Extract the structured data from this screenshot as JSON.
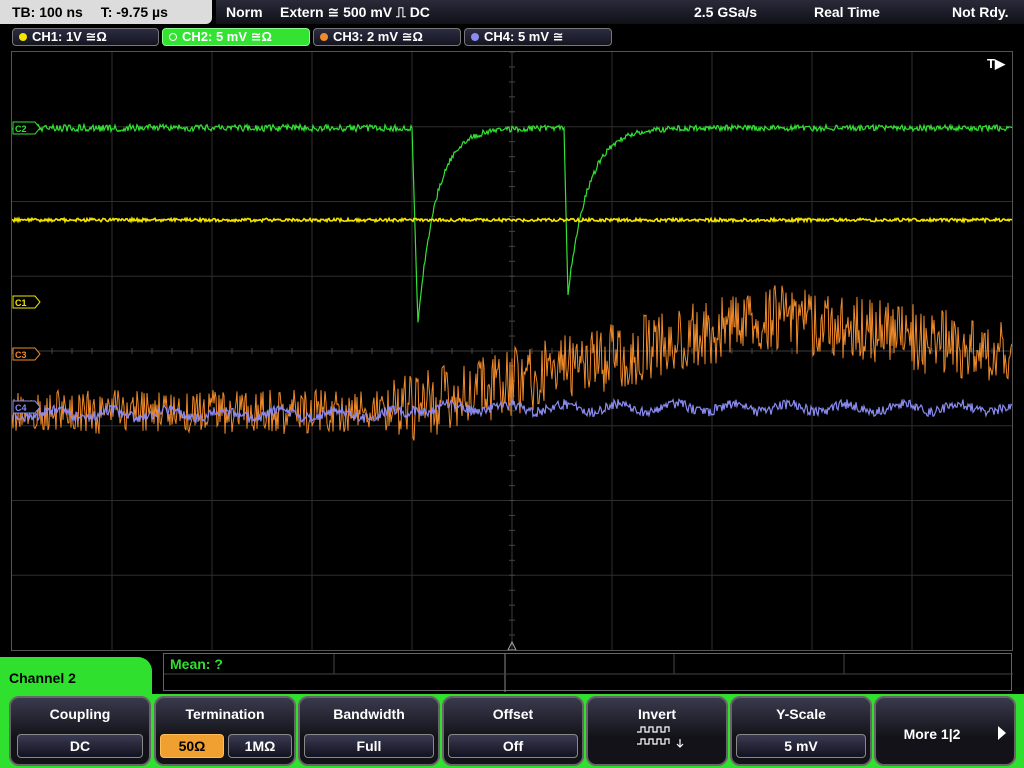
{
  "timebase": {
    "tb": "TB: 100 ns",
    "trigger_time": "T: -9.75 µs"
  },
  "status": {
    "mode": "Norm",
    "trigger_source": "Extern ≅ 500 mV ⎍ DC",
    "sample_rate": "2.5 GSa/s",
    "acquisition": "Real Time",
    "state": "Not Rdy."
  },
  "channels": [
    {
      "label": "CH1: 1V ≅Ω",
      "color": "#f2e600"
    },
    {
      "label": "CH2: 5 mV ≅Ω",
      "color": "#33e233"
    },
    {
      "label": "CH3: 2 mV ≅Ω",
      "color": "#f08a2a"
    },
    {
      "label": "CH4: 5 mV ≅",
      "color": "#8a8af0"
    }
  ],
  "screen": {
    "trigger_marker": "T▶",
    "markers": {
      "c1": "C1",
      "c3": "C3",
      "c4": "C4",
      "c2": "C2"
    }
  },
  "measurement": {
    "mean": "Mean: ?"
  },
  "panel": {
    "title": "Channel 2"
  },
  "softkeys": {
    "coupling": {
      "title": "Coupling",
      "value": "DC"
    },
    "termination": {
      "title": "Termination",
      "opt1": "50Ω",
      "opt2": "1MΩ"
    },
    "bandwidth": {
      "title": "Bandwidth",
      "value": "Full"
    },
    "offset": {
      "title": "Offset",
      "value": "Off"
    },
    "invert": {
      "title": "Invert"
    },
    "yscale": {
      "title": "Y-Scale",
      "value": "5 mV"
    },
    "more": {
      "label": "More 1|2"
    }
  },
  "colors": {
    "accent": "#2fe02f",
    "selected": "#f0a030",
    "grid": "#3a3a3a"
  }
}
